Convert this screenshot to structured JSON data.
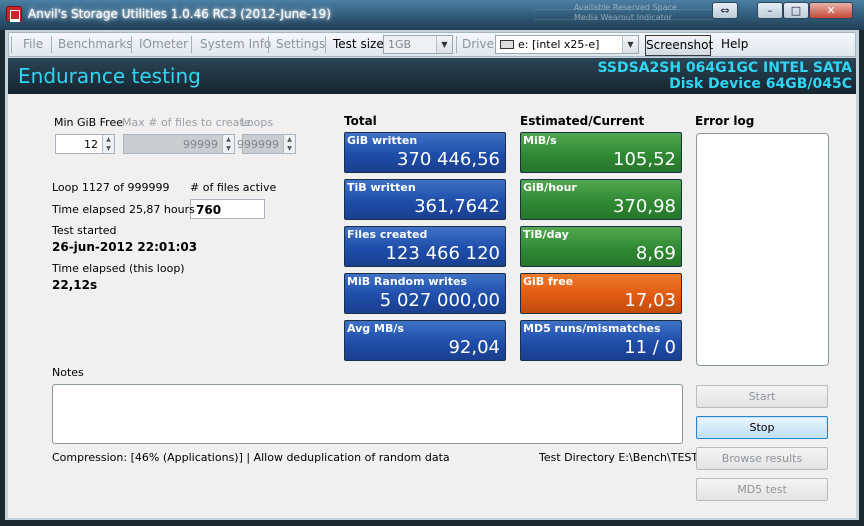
{
  "window": {
    "title": "Anvil's Storage Utilities 1.0.46 RC3 (2012-June-19)",
    "buttons": {
      "restore": "⇔",
      "minimize": "–",
      "maximize": "□",
      "close": "✕"
    },
    "background_ghost": [
      "Available Reserved Space",
      "Media Wearout Indicator"
    ]
  },
  "menu": {
    "file": "File",
    "benchmarks": "Benchmarks",
    "iometer": "IOmeter",
    "system_info": "System Info",
    "settings": "Settings",
    "test_size_label": "Test size",
    "test_size_value": "1GB",
    "drive_label": "Drive",
    "drive_value": "e: [intel x25-e]",
    "screenshot": "Screenshot",
    "help": "Help"
  },
  "header": {
    "title": "Endurance testing",
    "device_line1": "SSDSA2SH 064G1GC INTEL SATA",
    "device_line2": "Disk Device 64GB/045C"
  },
  "settings": {
    "min_gib_free_label": "Min GiB Free",
    "min_gib_free_value": "12",
    "max_files_label": "Max # of files to create",
    "max_files_value": "99999",
    "loops_label": "Loops",
    "loops_value": "999999"
  },
  "status": {
    "loop": "Loop 1127 of 999999",
    "files_active_label": "# of files active",
    "files_active_value": "760",
    "time_elapsed": "Time elapsed 25,87 hours",
    "test_started_label": "Test started",
    "test_started_value": "26-jun-2012 22:01:03",
    "loop_elapsed_label": "Time elapsed (this loop)",
    "loop_elapsed_value": "22,12s"
  },
  "totals": {
    "header": "Total",
    "tiles": [
      {
        "label": "GiB written",
        "value": "370 446,56"
      },
      {
        "label": "TiB written",
        "value": "361,7642"
      },
      {
        "label": "Files created",
        "value": "123 466 120"
      },
      {
        "label": "MiB Random writes",
        "value": "5 027 000,00"
      },
      {
        "label": "Avg MB/s",
        "value": "92,04"
      }
    ]
  },
  "estimated": {
    "header": "Estimated/Current",
    "tiles": [
      {
        "label": "MiB/s",
        "value": "105,52"
      },
      {
        "label": "GiB/hour",
        "value": "370,98"
      },
      {
        "label": "TiB/day",
        "value": "8,69"
      },
      {
        "label": "GiB free",
        "value": "17,03"
      },
      {
        "label": "MD5 runs/mismatches",
        "value": "11 / 0"
      }
    ]
  },
  "error_log": {
    "header": "Error log"
  },
  "notes": {
    "label": "Notes"
  },
  "footer": {
    "compression": "Compression: [46% (Applications)] | Allow deduplication of random data",
    "test_directory": "Test Directory E:\\Bench\\TEST"
  },
  "actions": {
    "start": "Start",
    "stop": "Stop",
    "browse": "Browse results",
    "md5": "MD5 test"
  },
  "colors": {
    "accent_cyan": "#30d5f4",
    "tile_blue": "#1e4da9",
    "tile_green": "#2f8a33",
    "tile_orange": "#e05b12"
  }
}
